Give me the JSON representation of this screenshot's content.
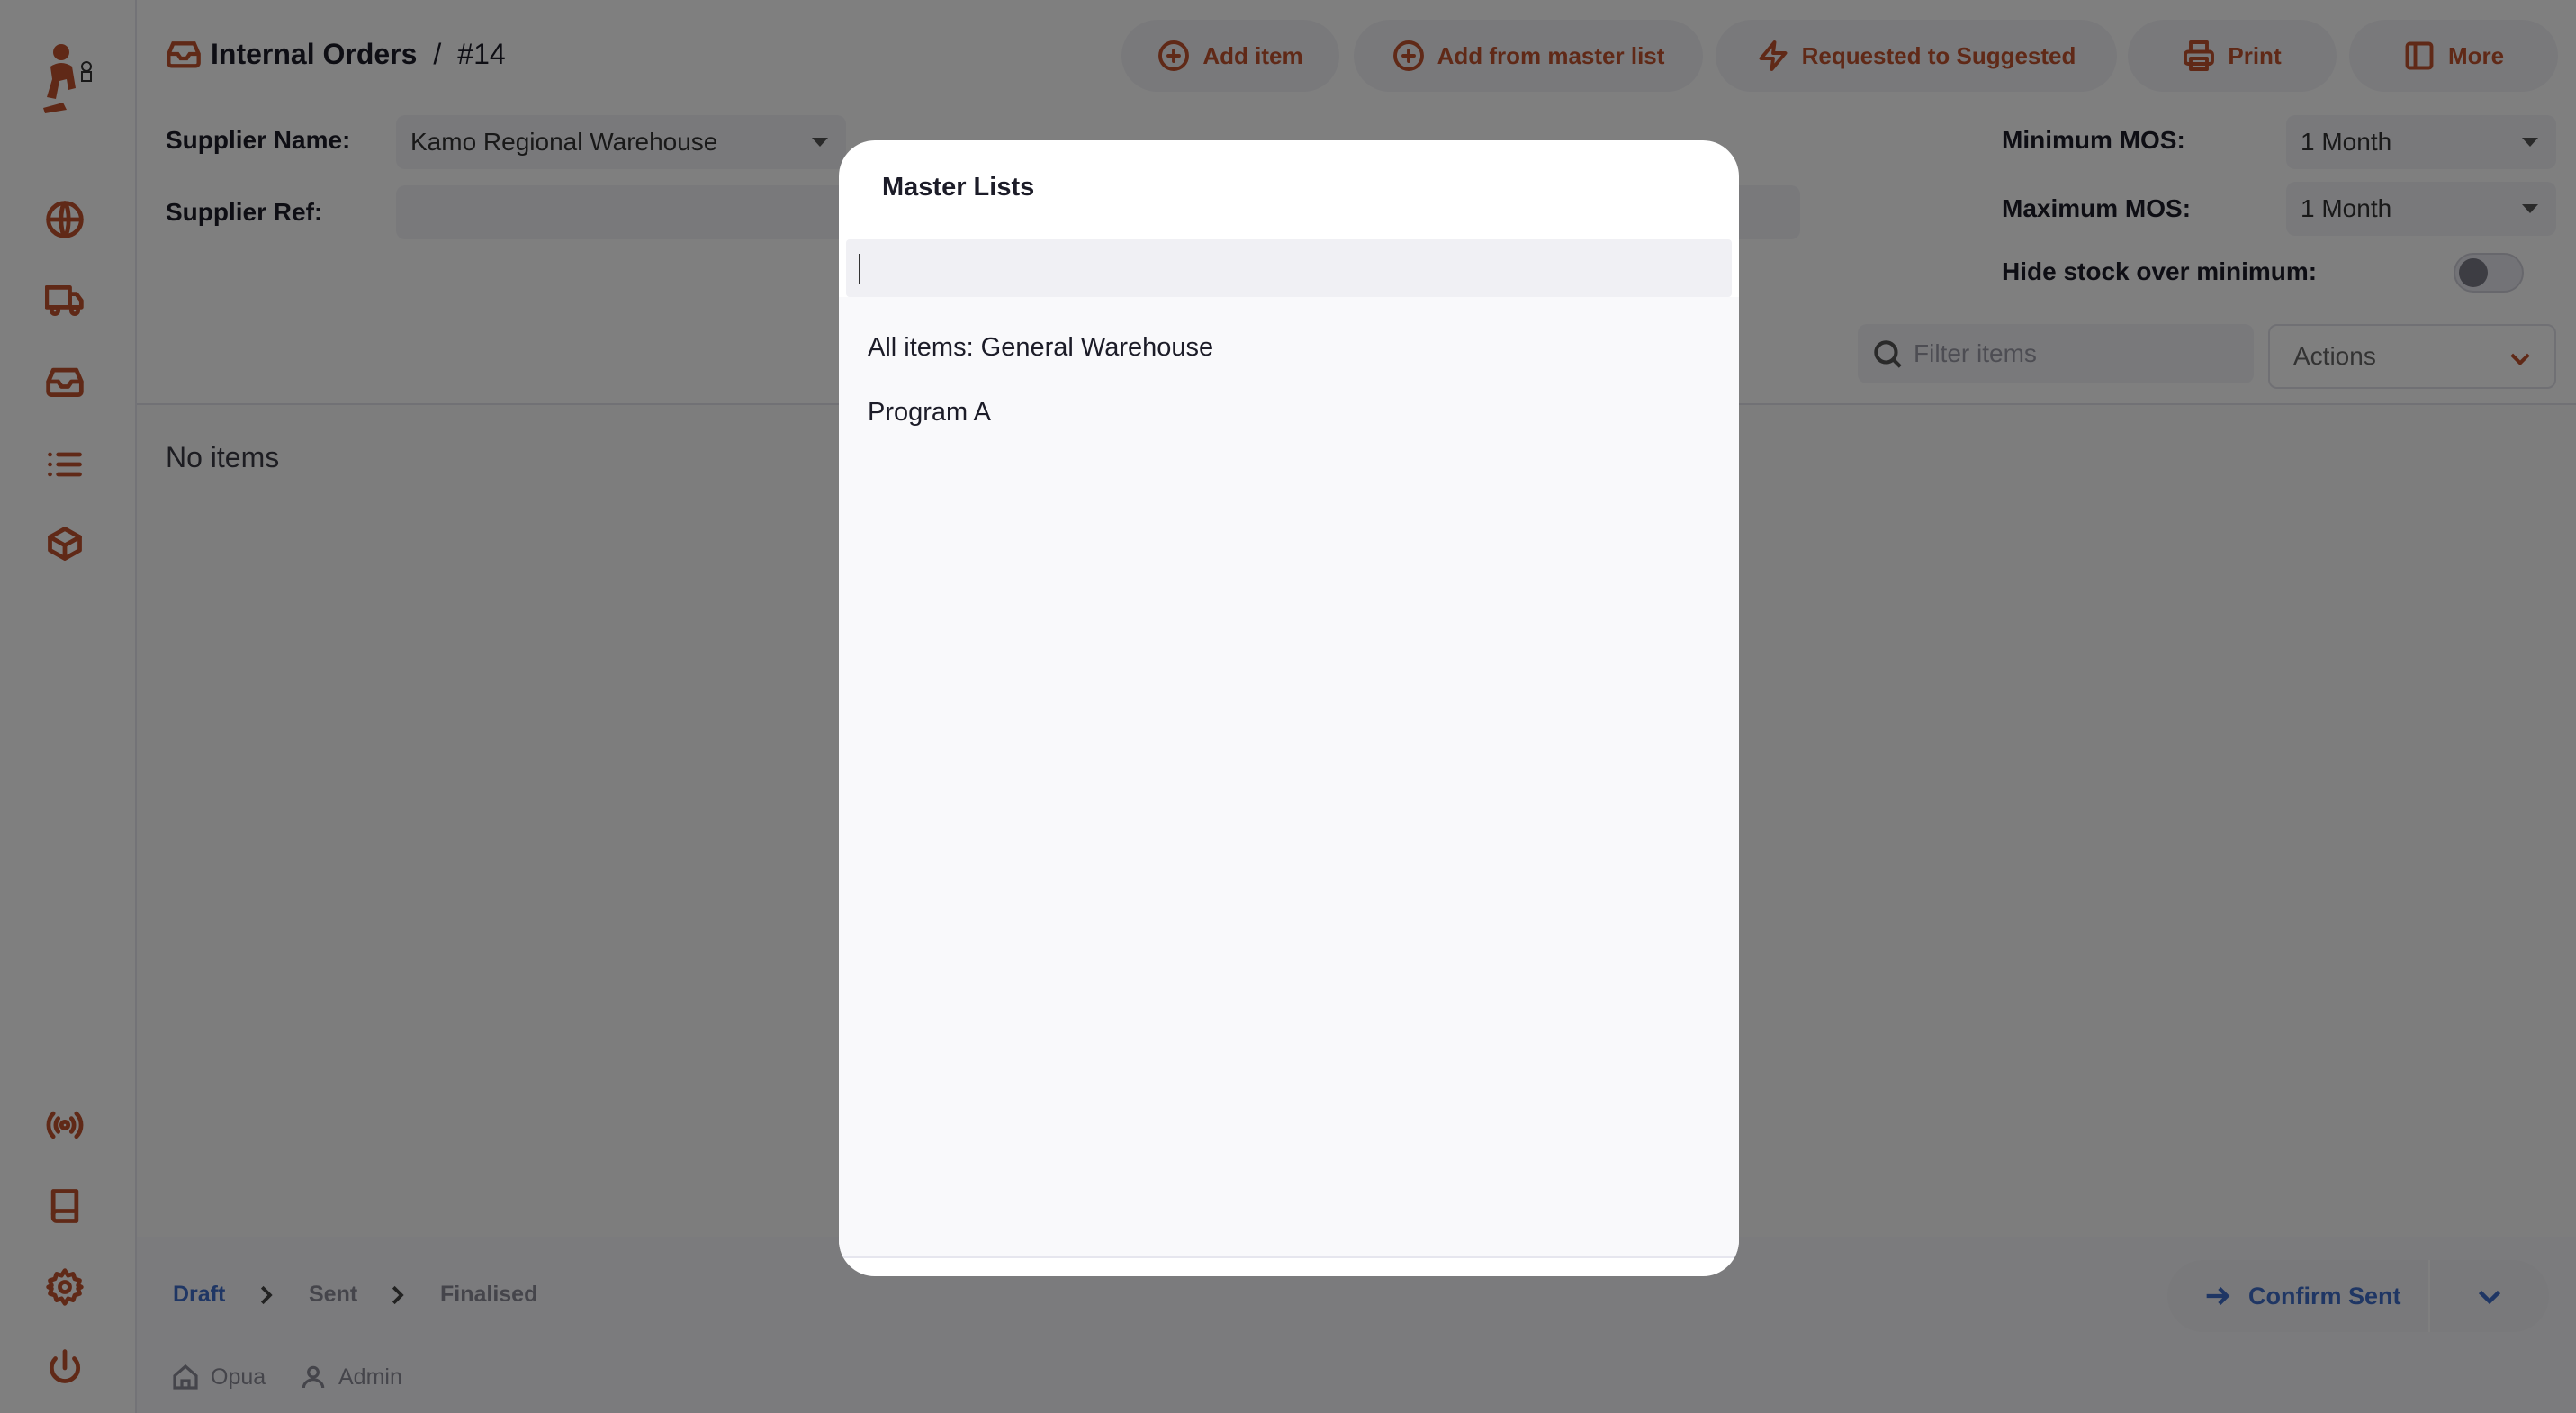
{
  "header": {
    "breadcrumb_title": "Internal Orders",
    "breadcrumb_sep": "/",
    "breadcrumb_number": "#14",
    "buttons": {
      "add_item": "Add item",
      "add_from_master_list": "Add from master list",
      "requested_to_suggested": "Requested to Suggested",
      "print": "Print",
      "more": "More"
    }
  },
  "form": {
    "supplier_name_label": "Supplier Name:",
    "supplier_name_value": "Kamo Regional Warehouse",
    "supplier_ref_label": "Supplier Ref:",
    "supplier_ref_value": "",
    "minimum_mos_label": "Minimum MOS:",
    "minimum_mos_value": "1 Month",
    "maximum_mos_label": "Maximum MOS:",
    "maximum_mos_value": "1 Month",
    "hide_stock_label": "Hide stock over minimum:",
    "hide_stock_on": false
  },
  "toolbar": {
    "filter_placeholder": "Filter items",
    "actions_label": "Actions"
  },
  "content": {
    "empty_text": "No items"
  },
  "footer": {
    "steps": [
      "Draft",
      "Sent",
      "Finalised"
    ],
    "active_step": "Draft",
    "confirm_label": "Confirm Sent",
    "store": "Opua",
    "user": "Admin"
  },
  "modal": {
    "title": "Master Lists",
    "search_value": "",
    "items": [
      "All items: General Warehouse",
      "Program A"
    ]
  },
  "colors": {
    "accent": "#c0532f",
    "primary_blue": "#3e6cc9",
    "overlay": "rgba(0,0,0,0.5)"
  },
  "icons": {
    "sidebar": [
      "globe-icon",
      "truck-icon",
      "inbox-icon",
      "list-icon",
      "box-icon",
      "broadcast-icon",
      "book-icon",
      "gear-icon",
      "power-icon"
    ]
  }
}
